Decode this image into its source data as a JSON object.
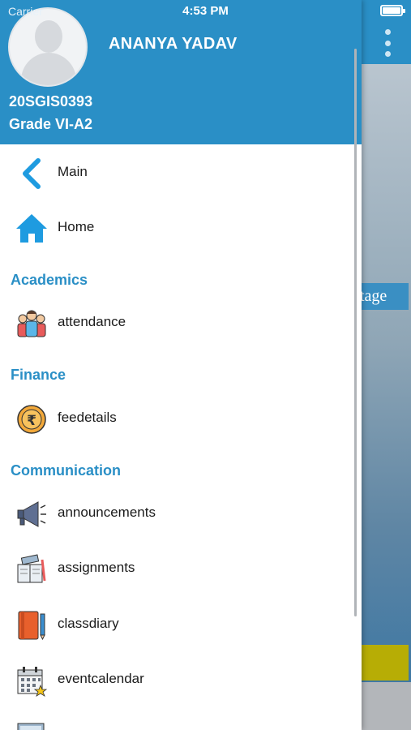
{
  "status_bar": {
    "carrier": "Carrier",
    "time": "4:53 PM"
  },
  "background": {
    "partial_text": "ntage"
  },
  "profile": {
    "name": "ANANYA YADAV",
    "student_id": "20SGIS0393",
    "grade": "Grade VI-A2"
  },
  "menu": {
    "main": {
      "label": "Main",
      "icon": "chevron-left-icon"
    },
    "home": {
      "label": "Home",
      "icon": "home-icon"
    },
    "sections": [
      {
        "title": "Academics",
        "items": [
          {
            "label": "attendance",
            "icon": "students-icon"
          }
        ]
      },
      {
        "title": "Finance",
        "items": [
          {
            "label": "feedetails",
            "icon": "rupee-coin-icon"
          }
        ]
      },
      {
        "title": "Communication",
        "items": [
          {
            "label": "announcements",
            "icon": "megaphone-icon"
          },
          {
            "label": "assignments",
            "icon": "book-pencil-icon"
          },
          {
            "label": "classdiary",
            "icon": "diary-icon"
          },
          {
            "label": "eventcalendar",
            "icon": "calendar-icon"
          }
        ]
      }
    ]
  },
  "colors": {
    "header": "#2a8fc6",
    "section_title": "#2a8fc6",
    "accent_yellow": "#b7ad05"
  }
}
